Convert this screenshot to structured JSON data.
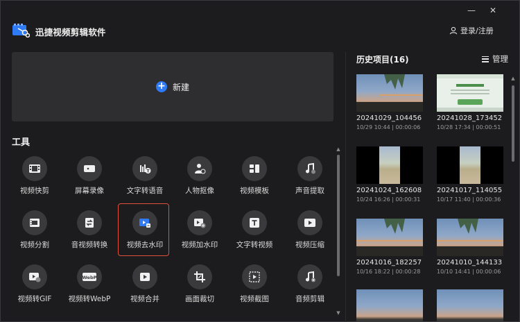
{
  "app": {
    "title": "迅捷视频剪辑软件",
    "login_label": "登录/注册",
    "window_buttons": {
      "minimize": "—",
      "close": "✕"
    }
  },
  "new_project": {
    "label": "新建",
    "icon": "plus-circle-icon"
  },
  "tools": {
    "heading": "工具",
    "items": [
      {
        "label": "视频快剪",
        "icon": "film-icon"
      },
      {
        "label": "屏幕录像",
        "icon": "screen-record-icon"
      },
      {
        "label": "文字转语音",
        "icon": "text-to-speech-icon"
      },
      {
        "label": "人物抠像",
        "icon": "person-cutout-icon"
      },
      {
        "label": "视频模板",
        "icon": "template-icon"
      },
      {
        "label": "声音提取",
        "icon": "music-note-icon"
      },
      {
        "label": "视频分割",
        "icon": "split-icon"
      },
      {
        "label": "音视频转换",
        "icon": "convert-icon"
      },
      {
        "label": "视频去水印",
        "icon": "remove-watermark-icon",
        "selected": true
      },
      {
        "label": "视频加水印",
        "icon": "add-watermark-icon"
      },
      {
        "label": "文字转视频",
        "icon": "text-to-video-icon"
      },
      {
        "label": "视频压缩",
        "icon": "compress-icon"
      },
      {
        "label": "视频转GIF",
        "icon": "gif-icon"
      },
      {
        "label": "视频转WebP",
        "icon": "webp-icon",
        "badge": "WebP"
      },
      {
        "label": "视频合并",
        "icon": "merge-icon"
      },
      {
        "label": "画面裁切",
        "icon": "crop-icon"
      },
      {
        "label": "视频截图",
        "icon": "screenshot-icon"
      },
      {
        "label": "音频剪辑",
        "icon": "audio-edit-icon"
      }
    ]
  },
  "history": {
    "title": "历史项目(16)",
    "manage_label": "管理",
    "items": [
      {
        "name": "20241029_104456",
        "meta": "10/29 10:44 | 00:00:06",
        "thumb": "sky"
      },
      {
        "name": "20241028_173452",
        "meta": "10/28 17:34 | 00:00:51",
        "thumb": "screen"
      },
      {
        "name": "20241024_162608",
        "meta": "10/24 16:26 | 00:00:31",
        "thumb": "portrait"
      },
      {
        "name": "20241017_114055",
        "meta": "10/17 11:40 | 00:00:36",
        "thumb": "portrait"
      },
      {
        "name": "20241016_182257",
        "meta": "10/16 18:22 | 00:00:28",
        "thumb": "sky"
      },
      {
        "name": "20241010_144133",
        "meta": "10/10 14:41 | 00:00:06",
        "thumb": "sky"
      },
      {
        "name": "",
        "meta": "",
        "thumb": "sky"
      },
      {
        "name": "",
        "meta": "",
        "thumb": "sky"
      }
    ]
  }
}
